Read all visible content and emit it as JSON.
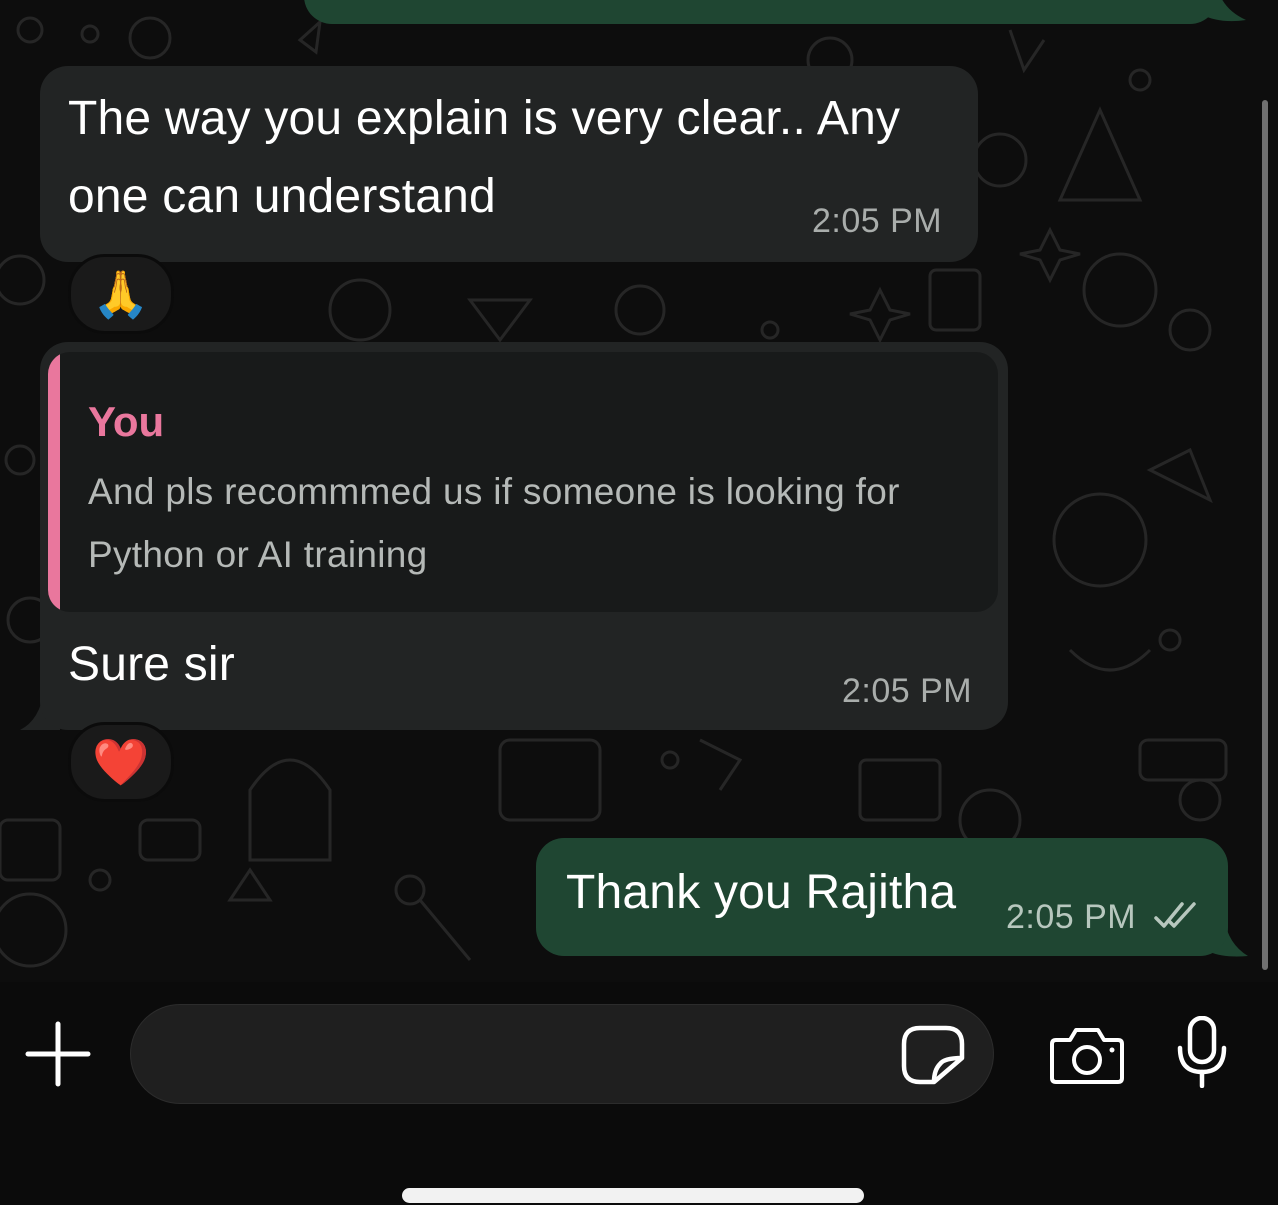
{
  "messages": [
    {
      "direction": "incoming",
      "text_line1": "The way you explain is very clear.. Any",
      "text_line2": "one can understand",
      "time": "2:05 PM",
      "reaction": "🙏"
    },
    {
      "direction": "incoming",
      "quote": {
        "author": "You",
        "text_line1": "And pls recommmed us if someone is looking for",
        "text_line2": "Python or AI training"
      },
      "text": "Sure sir",
      "time": "2:05 PM",
      "reaction": "❤️"
    },
    {
      "direction": "outgoing",
      "text": "Thank you Rajitha",
      "time": "2:05 PM",
      "status": "read"
    }
  ],
  "composer": {
    "value": "",
    "placeholder": ""
  },
  "icons": {
    "attach": "plus-icon",
    "sticker": "sticker-icon",
    "camera": "camera-icon",
    "mic": "microphone-icon",
    "read_receipt": "double-check-icon"
  },
  "colors": {
    "incoming_bubble": "#222424",
    "outgoing_bubble": "#1f4632",
    "quote_accent": "#e9779d",
    "background": "#0d0d0d"
  }
}
